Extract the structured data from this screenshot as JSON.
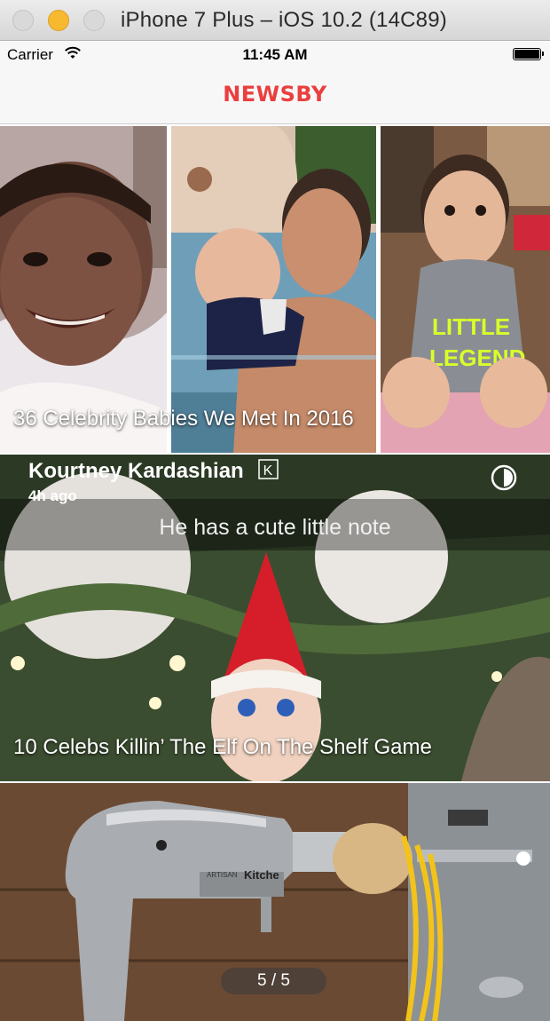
{
  "window": {
    "title": "iPhone 7 Plus – iOS 10.2 (14C89)"
  },
  "status_bar": {
    "carrier": "Carrier",
    "time": "11:45 AM"
  },
  "app": {
    "logo": "NEWSBY"
  },
  "cards": [
    {
      "caption": "36 Celebrity Babies We Met In 2016"
    },
    {
      "caption": "10 Celebs Killin’ The Elf On The Shelf Game",
      "snap": {
        "user": "Kourtney Kardashian",
        "badge": "K",
        "time": "4h ago",
        "text": "He has a cute little note"
      }
    },
    {
      "caption": "",
      "pager": "5 / 5",
      "brand_text": "Kitche",
      "model_text": "ARTISAN"
    }
  ],
  "icons": [
    "wifi-icon",
    "battery-icon",
    "timer-icon"
  ],
  "colors": {
    "logo": "#ea3f3f",
    "minimize": "#f7b92f"
  }
}
